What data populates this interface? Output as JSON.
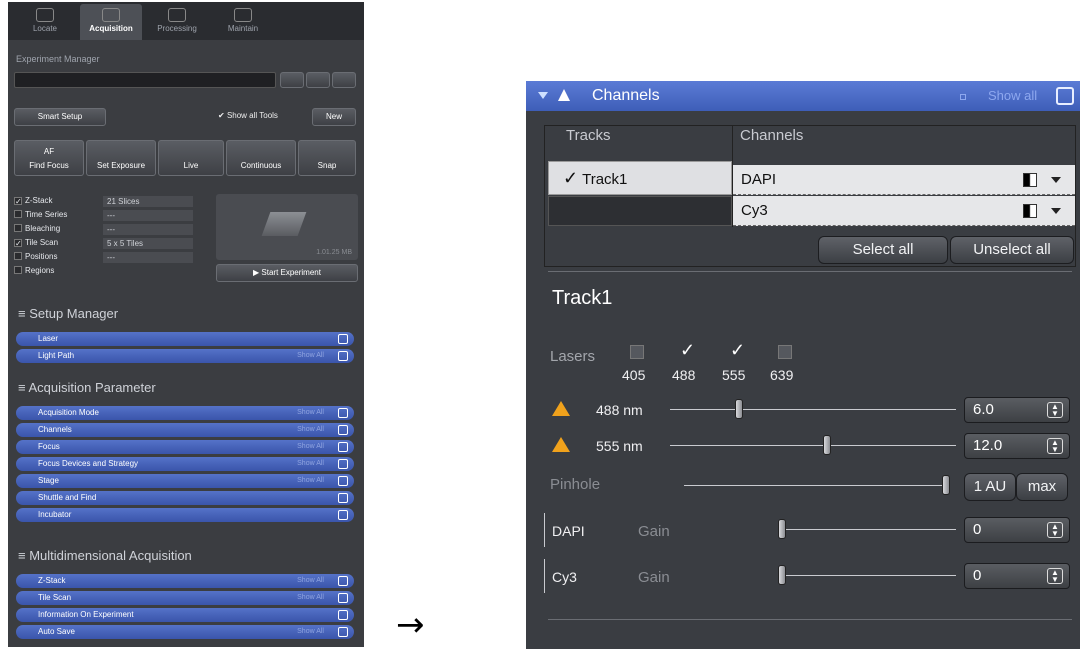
{
  "left_panel": {
    "tabs": [
      "Locate",
      "Acquisition",
      "Processing",
      "Maintain"
    ],
    "experiment_manager": "Experiment Manager",
    "smart_setup": "Smart Setup",
    "show_all_tools": "Show all Tools",
    "new": "New",
    "actions": [
      "AF",
      "Find Focus",
      "Set Exposure",
      "Live",
      "Continuous",
      "Snap"
    ],
    "options": [
      {
        "label": "Z-Stack",
        "checked": true,
        "value": "21 Slices"
      },
      {
        "label": "Time Series",
        "checked": false,
        "value": "---"
      },
      {
        "label": "Bleaching",
        "checked": false,
        "value": "---"
      },
      {
        "label": "Tile Scan",
        "checked": true,
        "value": "5 x 5 Tiles"
      },
      {
        "label": "Positions",
        "checked": false,
        "value": "---"
      },
      {
        "label": "Regions",
        "checked": false,
        "value": ""
      }
    ],
    "preview_size": "1.01.25 MB",
    "start_experiment": "Start Experiment",
    "groups": [
      {
        "title": "Setup Manager",
        "items": [
          "Laser",
          "Light Path"
        ]
      },
      {
        "title": "Acquisition Parameter",
        "items": [
          "Acquisition Mode",
          "Channels",
          "Focus",
          "Focus Devices and Strategy",
          "Stage",
          "Shuttle and Find",
          "Incubator"
        ]
      },
      {
        "title": "Multidimensional Acquisition",
        "items": [
          "Z-Stack",
          "Tile Scan",
          "Information On Experiment",
          "Auto Save"
        ]
      }
    ],
    "show_all_small": "Show All"
  },
  "arrow": "→",
  "channels_panel": {
    "title": "Channels",
    "show_all": "Show all",
    "col_tracks": "Tracks",
    "col_channels": "Channels",
    "track_name": "Track1",
    "channels": [
      "DAPI",
      "Cy3"
    ],
    "select_all": "Select all",
    "unselect_all": "Unselect all",
    "track_heading": "Track1",
    "lasers_label": "Lasers",
    "lasers": [
      {
        "nm": "405",
        "checked": false
      },
      {
        "nm": "488",
        "checked": true
      },
      {
        "nm": "555",
        "checked": true
      },
      {
        "nm": "639",
        "checked": false
      }
    ],
    "laser_power": [
      {
        "label": "488 nm",
        "value": "6.0",
        "level": 0.24
      },
      {
        "label": "555 nm",
        "value": "12.0",
        "level": 0.55
      }
    ],
    "pinhole": {
      "label": "Pinhole",
      "value": "1 AU",
      "max": "max",
      "level": 1.0
    },
    "gains": [
      {
        "channel": "DAPI",
        "label": "Gain",
        "value": "0",
        "level": 0.0
      },
      {
        "channel": "Cy3",
        "label": "Gain",
        "value": "0",
        "level": 0.0
      }
    ]
  }
}
